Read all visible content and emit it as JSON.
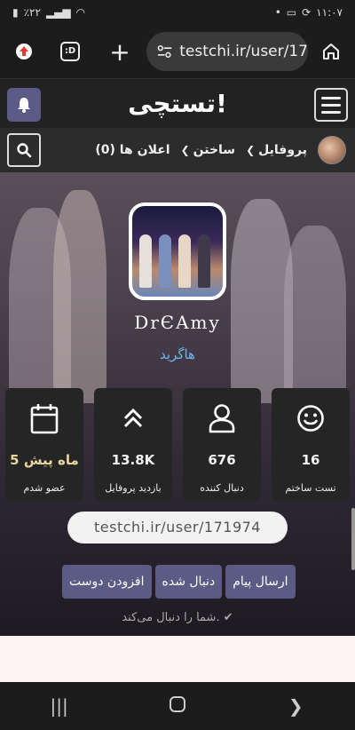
{
  "statusbar": {
    "battery": "٪۲۲",
    "time": "۱۱:۰۷"
  },
  "browser": {
    "url": "testchi.ir/user/17",
    "new_tab": "+",
    "tab_count": ":D"
  },
  "site": {
    "logo": "تستچی!"
  },
  "nav": {
    "profile": "پروفایل",
    "create": "ساختن",
    "notifications": "اعلان ها (0)"
  },
  "profile": {
    "username": "DrЄAmy",
    "role": "هاگرید",
    "stats": [
      {
        "icon": "calendar-icon",
        "value": "5 ماه پیش",
        "label": "عضو شدم"
      },
      {
        "icon": "chevrons-up-icon",
        "value": "13.8K",
        "label": "بازدید پروفایل"
      },
      {
        "icon": "user-icon",
        "value": "676",
        "label": "دنبال کننده"
      },
      {
        "icon": "smiley-icon",
        "value": "16",
        "label": "تست ساختم"
      }
    ],
    "url": "testchi.ir/user/171974",
    "actions": {
      "add_friend": "افزودن دوست",
      "followed": "دنبال شده",
      "send_message": "ارسال پیام"
    },
    "follow_note": "شما را دنبال می‌کند."
  },
  "colors": {
    "accent": "#5b5b86",
    "link": "#6cb6ea"
  }
}
